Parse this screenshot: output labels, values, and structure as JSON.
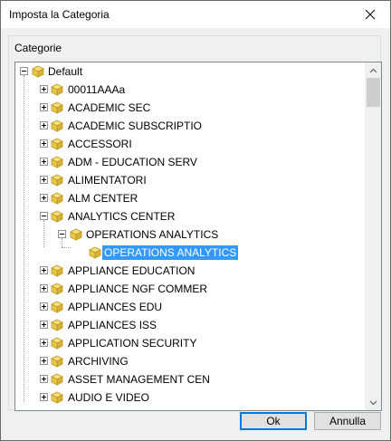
{
  "window": {
    "title": "Imposta la Categoria"
  },
  "group": {
    "label": "Categorie"
  },
  "tree": {
    "root": "Default",
    "items": [
      "00011AAAa",
      "ACADEMIC SEC",
      "ACADEMIC SUBSCRIPTIO",
      "ACCESSORI",
      "ADM - EDUCATION SERV",
      "ALIMENTATORI",
      "ALM CENTER",
      "ANALYTICS CENTER",
      "OPERATIONS ANALYTICS",
      "OPERATIONS ANALYTICS",
      "APPLIANCE EDUCATION",
      "APPLIANCE NGF COMMER",
      "APPLIANCES EDU",
      "APPLIANCES ISS",
      "APPLICATION SECURITY",
      "ARCHIVING",
      "ASSET MANAGEMENT CEN",
      "AUDIO E VIDEO"
    ]
  },
  "buttons": {
    "ok": "Ok",
    "cancel": "Annulla"
  },
  "colors": {
    "selection": "#3399ff",
    "accent": "#0078d7"
  }
}
